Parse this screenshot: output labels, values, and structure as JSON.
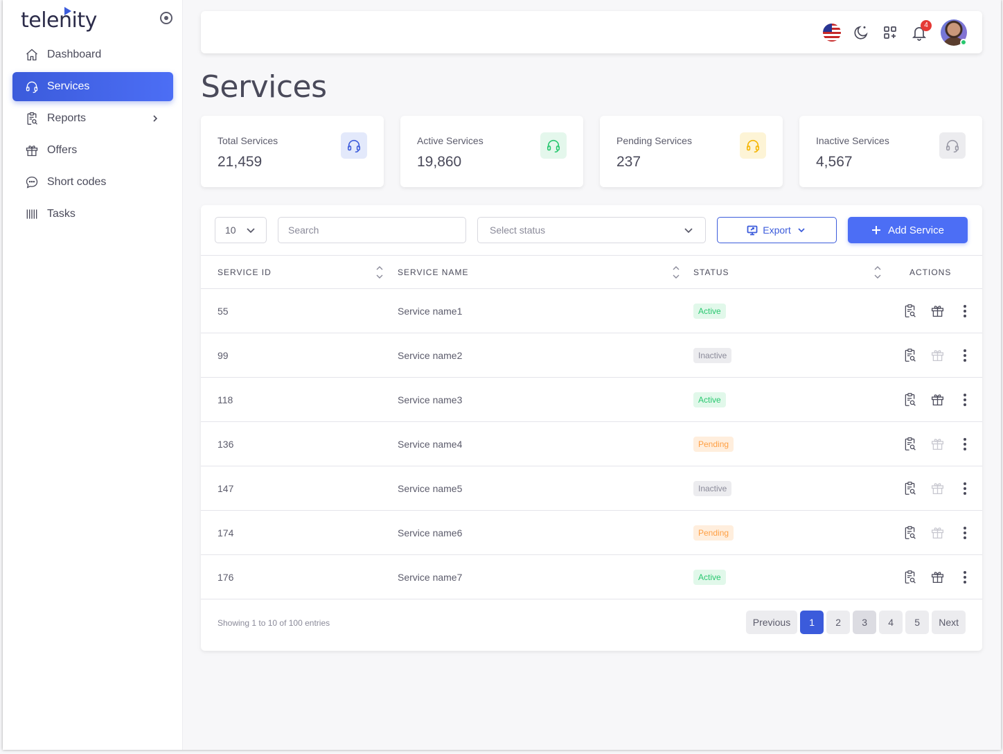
{
  "brand": {
    "name": "telenity"
  },
  "sidebar": {
    "items": [
      {
        "label": "Dashboard",
        "icon": "home-icon"
      },
      {
        "label": "Services",
        "icon": "headset-icon",
        "active": true
      },
      {
        "label": "Reports",
        "icon": "clipboard-search-icon",
        "has_submenu": true
      },
      {
        "label": "Offers",
        "icon": "gift-icon"
      },
      {
        "label": "Short codes",
        "icon": "chat-bubble-icon"
      },
      {
        "label": "Tasks",
        "icon": "barcode-icon"
      }
    ]
  },
  "topbar": {
    "language": "us-flag-icon",
    "notifications_count": "4"
  },
  "page": {
    "title": "Services"
  },
  "stats": [
    {
      "label": "Total Services",
      "value": "21,459",
      "color": "#3b5bdb",
      "bg": "#e3e9fb"
    },
    {
      "label": "Active Services",
      "value": "19,860",
      "color": "#28c76f",
      "bg": "#e4f7ec"
    },
    {
      "label": "Pending Services",
      "value": "237",
      "color": "#f5b400",
      "bg": "#fdf4d6"
    },
    {
      "label": "Inactive Services",
      "value": "4,567",
      "color": "#9a9aa6",
      "bg": "#ececef"
    }
  ],
  "controls": {
    "page_length": "10",
    "search_placeholder": "Search",
    "status_placeholder": "Select status",
    "export_label": "Export",
    "add_label": "Add Service"
  },
  "table": {
    "headers": [
      "SERVICE ID",
      "SERVICE NAME",
      "STATUS",
      "ACTIONS"
    ],
    "rows": [
      {
        "id": "55",
        "name": "Service name1",
        "status": "Active"
      },
      {
        "id": "99",
        "name": "Service name2",
        "status": "Inactive"
      },
      {
        "id": "118",
        "name": "Service name3",
        "status": "Active"
      },
      {
        "id": "136",
        "name": "Service name4",
        "status": "Pending"
      },
      {
        "id": "147",
        "name": "Service name5",
        "status": "Inactive"
      },
      {
        "id": "174",
        "name": "Service name6",
        "status": "Pending"
      },
      {
        "id": "176",
        "name": "Service name7",
        "status": "Active"
      }
    ]
  },
  "footer": {
    "info": "Showing 1 to 10 of 100 entries",
    "previous": "Previous",
    "next": "Next",
    "pages": [
      "1",
      "2",
      "3",
      "4",
      "5"
    ],
    "current_page": "1"
  }
}
